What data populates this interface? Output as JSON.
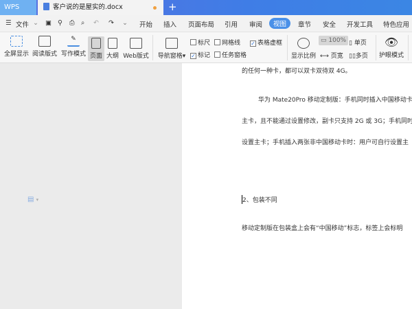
{
  "app": {
    "name": "WPS",
    "doc_tab": "客户说的是屋实的.docx",
    "new_tab": "+"
  },
  "menu": {
    "file": "文件",
    "tabs": [
      "开始",
      "插入",
      "页面布局",
      "引用",
      "审阅",
      "视图",
      "章节",
      "安全",
      "开发工具",
      "特色应用"
    ],
    "active": "视图"
  },
  "ribbon": {
    "fullscreen": "全屏显示",
    "read": "阅读版式",
    "write": "写作模式",
    "page": "页面",
    "outline": "大纲",
    "web": "Web版式",
    "nav": "导航窗格",
    "ruler": "标尺",
    "grid": "网格线",
    "table_grid": "表格虚框",
    "mark": "标记",
    "task": "任务窗格",
    "zoom": "显示比例",
    "zoom100": "100%",
    "page_width": "页宽",
    "single": "单页",
    "multi": "多页",
    "eye": "护眼模式"
  },
  "checks": {
    "ruler": false,
    "grid": false,
    "table_grid": true,
    "mark": true,
    "task": false
  },
  "doc": {
    "lines": [
      "的任何一种卡，都可以双卡双待双 4G。",
      "华为 Mate20Pro 移动定制版：手机同时插入中国移动卡",
      "主卡，且不能通过设置修改，副卡只支持 2G 或 3G；手机同时",
      "设置主卡；手机插入两张非中国移动卡时：用户可自行设置主",
      "2、包装不同",
      "移动定制版在包装盒上会有“中国移动”标志，标签上会标明"
    ]
  }
}
